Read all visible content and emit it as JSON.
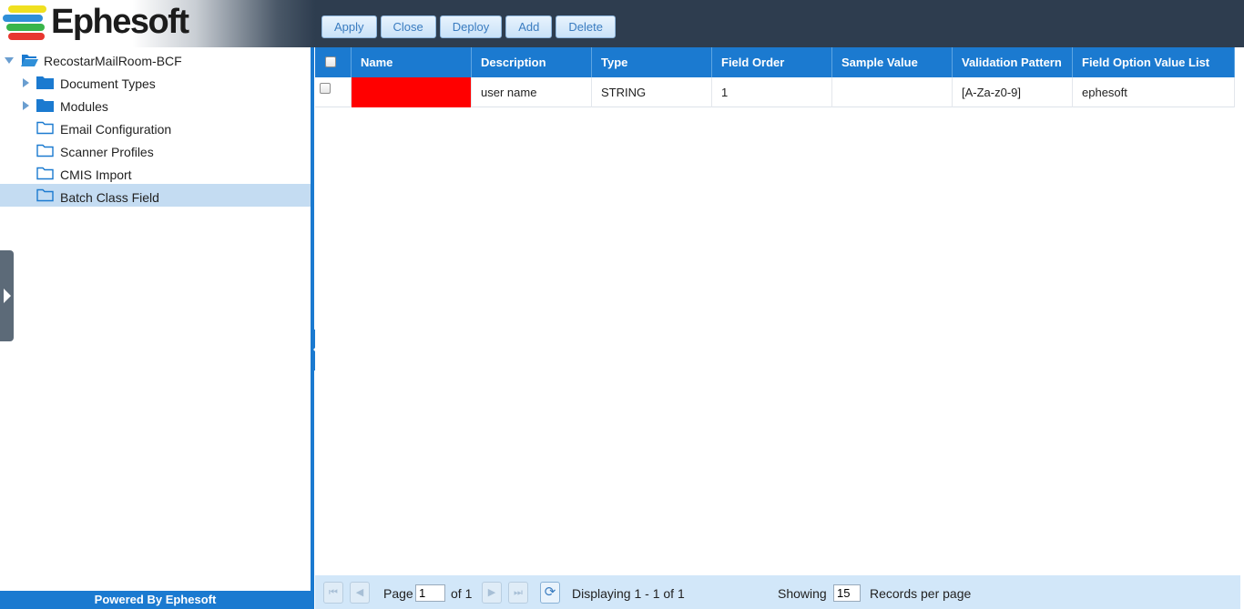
{
  "app": {
    "logo_text": "Ephesoft",
    "colors": {
      "accent": "#1b7ad0",
      "header_bg": "#2e3d4f",
      "selected_row": "#c4dcf2",
      "redacted": "#ff0000"
    }
  },
  "toolbar": {
    "apply": "Apply",
    "close": "Close",
    "deploy": "Deploy",
    "add": "Add",
    "delete": "Delete"
  },
  "tree": {
    "root": "RecostarMailRoom-BCF",
    "items": [
      {
        "label": "Document Types",
        "expandable": true
      },
      {
        "label": "Modules",
        "expandable": true
      },
      {
        "label": "Email Configuration",
        "expandable": false
      },
      {
        "label": "Scanner Profiles",
        "expandable": false
      },
      {
        "label": "CMIS Import",
        "expandable": false
      },
      {
        "label": "Batch Class Field",
        "expandable": false,
        "selected": true
      }
    ]
  },
  "footer": {
    "powered_by": "Powered By Ephesoft"
  },
  "grid": {
    "columns": [
      "Name",
      "Description",
      "Type",
      "Field Order",
      "Sample Value",
      "Validation Pattern",
      "Field Option Value List"
    ],
    "rows": [
      {
        "name": "",
        "description": "user name",
        "type": "STRING",
        "field_order": "1",
        "sample_value": "",
        "validation_pattern": "[A-Za-z0-9]",
        "field_option_value_list": "ephesoft"
      }
    ]
  },
  "pager": {
    "page_label": "Page",
    "page_value": "1",
    "of_label": "of 1",
    "displaying": "Displaying 1 - 1 of 1",
    "showing_label": "Showing",
    "records_value": "15",
    "records_label": "Records per page"
  }
}
